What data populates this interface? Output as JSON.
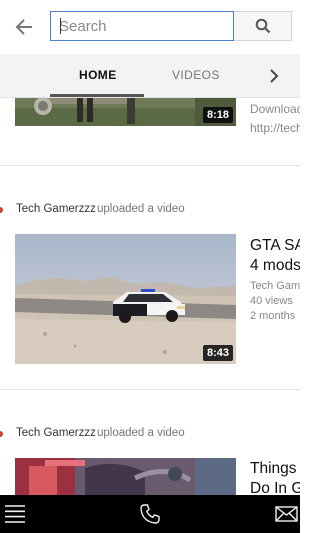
{
  "search": {
    "placeholder": "Search",
    "value": ""
  },
  "tabs": [
    {
      "label": "HOME",
      "selected": true
    },
    {
      "label": "VIDEOS",
      "selected": false
    }
  ],
  "feed": {
    "partial_item": {
      "duration": "8:18",
      "description_lines": [
        "Download",
        "http://tech"
      ]
    },
    "items": [
      {
        "channel": "Tech Gamerzzz",
        "action": "uploaded a video",
        "duration": "8:43",
        "title_lines": [
          "GTA SA",
          "4 mods"
        ],
        "channel_short": "Tech Gam",
        "views": "40 views",
        "age": "2 months"
      },
      {
        "channel": "Tech Gamerzzz",
        "action": "uploaded a video",
        "title_lines": [
          "Things",
          "Do In G"
        ]
      }
    ]
  },
  "icons": {
    "back": "arrow-left-icon",
    "search": "magnifier-icon",
    "tabs_next": "chevron-right-icon",
    "menu": "hamburger-menu-icon",
    "phone": "phone-icon",
    "mail": "envelope-icon"
  },
  "colors": {
    "search_border": "#4a7fd4",
    "tab_underline": "#555555",
    "bottom_bar": "#000000",
    "channel_dot": "#c9442d"
  }
}
